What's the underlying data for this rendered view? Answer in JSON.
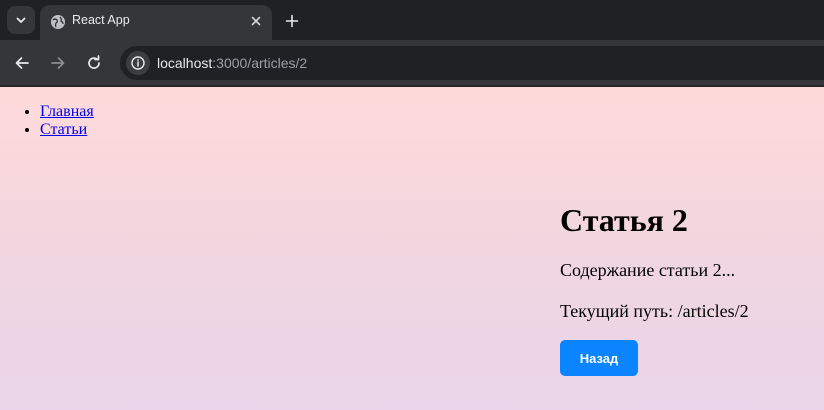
{
  "browser": {
    "tab": {
      "title": "React App",
      "favicon": "globe-icon"
    },
    "address_bar": {
      "host": "localhost",
      "path": ":3000/articles/2"
    },
    "colors": {
      "accent": "#0a84ff",
      "link": "#0000ee"
    }
  },
  "nav": {
    "items": [
      {
        "label": "Главная"
      },
      {
        "label": "Статьи"
      }
    ]
  },
  "article": {
    "title": "Статья 2",
    "content": "Содержание статьи 2...",
    "current_path": "Текущий путь: /articles/2",
    "back_label": "Назад"
  }
}
